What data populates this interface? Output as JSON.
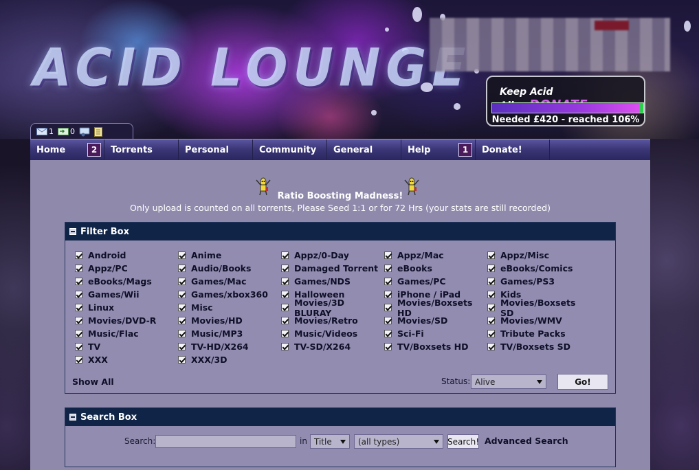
{
  "header": {
    "logo_text": "ACID LOUNGE",
    "donate": {
      "prefix": "Keep Acid Alive",
      "donate_label": "DONATE",
      "progress_percent": 106,
      "status_text": "Needed £420 - reached 106%"
    },
    "user_bar": {
      "messages_count": "1",
      "inbox_count": "0"
    }
  },
  "nav": {
    "items": [
      {
        "label": "Home",
        "badge": "2"
      },
      {
        "label": "Torrents",
        "badge": ""
      },
      {
        "label": "Personal",
        "badge": ""
      },
      {
        "label": "Community",
        "badge": ""
      },
      {
        "label": "General",
        "badge": ""
      },
      {
        "label": "Help",
        "badge": "1"
      },
      {
        "label": "Donate!",
        "badge": ""
      }
    ]
  },
  "announcement": {
    "title": "Ratio Boosting Madness!",
    "subtitle": "Only upload is counted on all torrents, Please Seed 1:1 or for 72 Hrs (your stats are still recorded)"
  },
  "filter_box": {
    "title": "Filter Box",
    "categories": [
      "Android",
      "Anime",
      "Appz/0-Day",
      "Appz/Mac",
      "Appz/Misc",
      "Appz/PC",
      "Audio/Books",
      "Damaged Torrent",
      "eBooks",
      "eBooks/Comics",
      "eBooks/Mags",
      "Games/Mac",
      "Games/NDS",
      "Games/PC",
      "Games/PS3",
      "Games/Wii",
      "Games/xbox360",
      "Halloween",
      "iPhone / iPad",
      "Kids",
      "Linux",
      "Misc",
      "Movies/3D BLURAY",
      "Movies/Boxsets HD",
      "Movies/Boxsets SD",
      "Movies/DVD-R",
      "Movies/HD",
      "Movies/Retro",
      "Movies/SD",
      "Movies/WMV",
      "Music/Flac",
      "Music/MP3",
      "Music/Videos",
      "Sci-Fi",
      "Tribute Packs",
      "TV",
      "TV-HD/X264",
      "TV-SD/X264",
      "TV/Boxsets HD",
      "TV/Boxsets SD",
      "XXX",
      "XXX/3D"
    ],
    "show_all_label": "Show All",
    "status_label": "Status:",
    "status_value": "Alive",
    "go_label": "Go!"
  },
  "search_box": {
    "title": "Search Box",
    "search_label": "Search:",
    "search_value": "",
    "in_label": "in",
    "field_value": "Title",
    "type_value": "(all types)",
    "submit_label": "Search!",
    "advanced_label": "Advanced Search"
  }
}
